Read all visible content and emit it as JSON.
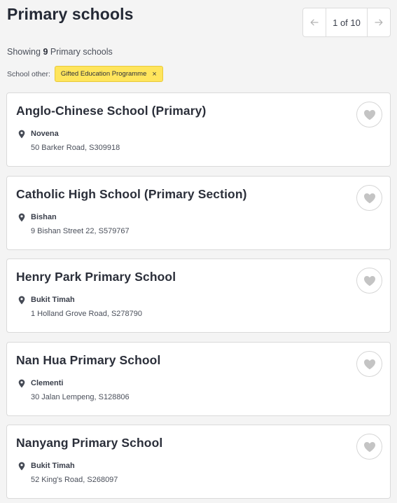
{
  "header": {
    "title": "Primary schools"
  },
  "pager": {
    "prev_icon": "arrow-left-icon",
    "next_icon": "arrow-right-icon",
    "label": "1 of 10"
  },
  "results": {
    "prefix": "Showing ",
    "count": "9",
    "suffix": " Primary schools"
  },
  "filter": {
    "label": "School other:",
    "chip": "Gifted Education Programme",
    "remove": "×"
  },
  "schools": [
    {
      "name": "Anglo-Chinese School (Primary)",
      "area": "Novena",
      "address": "50 Barker Road, S309918"
    },
    {
      "name": "Catholic High School (Primary Section)",
      "area": "Bishan",
      "address": "9 Bishan Street 22, S579767"
    },
    {
      "name": "Henry Park Primary School",
      "area": "Bukit Timah",
      "address": "1 Holland Grove Road, S278790"
    },
    {
      "name": "Nan Hua Primary School",
      "area": "Clementi",
      "address": "30 Jalan Lempeng, S128806"
    },
    {
      "name": "Nanyang Primary School",
      "area": "Bukit Timah",
      "address": "52 King's Road, S268097"
    }
  ],
  "colors": {
    "chip_bg": "#ffe55c",
    "text": "#2b2f3a",
    "icon": "#c4c4c4"
  }
}
